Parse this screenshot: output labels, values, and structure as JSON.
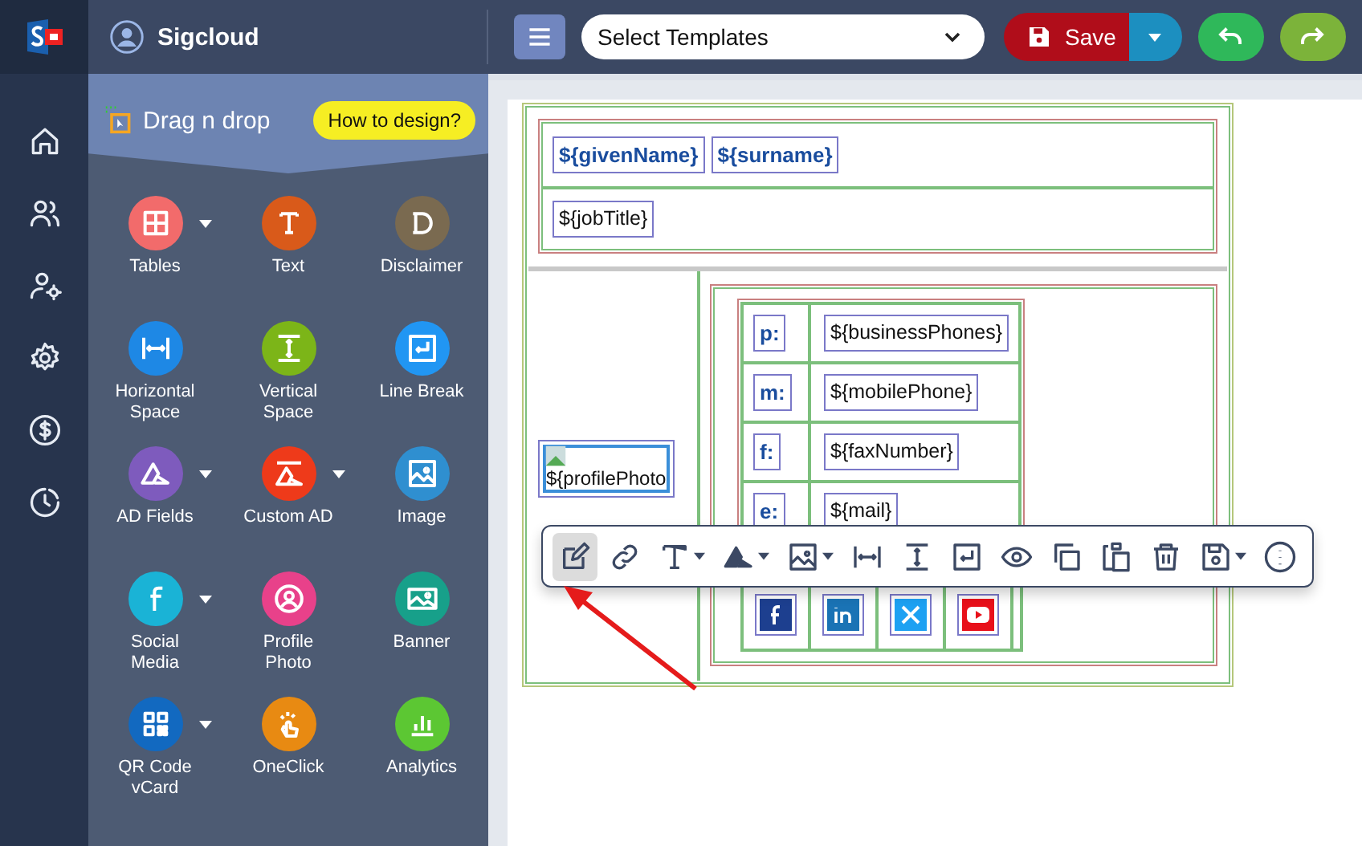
{
  "header": {
    "brand": "Sigcloud",
    "template_select": {
      "placeholder": "Select Templates"
    },
    "save_label": "Save"
  },
  "rail": [
    {
      "kind": "home"
    },
    {
      "kind": "users"
    },
    {
      "kind": "user-settings"
    },
    {
      "kind": "settings"
    },
    {
      "kind": "dollar"
    },
    {
      "kind": "clock"
    }
  ],
  "panel": {
    "title": "Drag n drop",
    "help_button": "How to design?",
    "items": [
      {
        "label": "Tables",
        "kind": "tables",
        "color": "#f26b6b",
        "dropdown": true
      },
      {
        "label": "Text",
        "kind": "text",
        "color": "#d95a1a",
        "dropdown": false
      },
      {
        "label": "Disclaimer",
        "kind": "disclaimer",
        "color": "#7a6a50",
        "dropdown": false
      },
      {
        "label": "Horizontal Space",
        "kind": "hspace",
        "color": "#1e88e5",
        "dropdown": false
      },
      {
        "label": "Vertical Space",
        "kind": "vspace",
        "color": "#7cb518",
        "dropdown": false
      },
      {
        "label": "Line Break",
        "kind": "linebreak",
        "color": "#2196f3",
        "dropdown": false
      },
      {
        "label": "AD Fields",
        "kind": "ad",
        "color": "#7e5bbd",
        "dropdown": true
      },
      {
        "label": "Custom AD",
        "kind": "customad",
        "color": "#ee3a1a",
        "dropdown": true
      },
      {
        "label": "Image",
        "kind": "image",
        "color": "#2f8fd0",
        "dropdown": false
      },
      {
        "label": "Social Media",
        "kind": "social",
        "color": "#1ab3d6",
        "dropdown": true
      },
      {
        "label": "Profile Photo",
        "kind": "profile",
        "color": "#e8418a",
        "dropdown": false
      },
      {
        "label": "Banner",
        "kind": "banner",
        "color": "#17a08a",
        "dropdown": false
      },
      {
        "label": "QR Code vCard",
        "kind": "qr",
        "color": "#1269c0",
        "dropdown": true
      },
      {
        "label": "OneClick",
        "kind": "oneclick",
        "color": "#e88a12",
        "dropdown": false
      },
      {
        "label": "Analytics",
        "kind": "analytics",
        "color": "#5cc733",
        "dropdown": false
      }
    ]
  },
  "signature": {
    "name_fields": [
      "${givenName}",
      "${surname}"
    ],
    "job_title": "${jobTitle}",
    "profile_photo": "${profilePhoto",
    "contacts": [
      {
        "label": "p:",
        "value": "${businessPhones}"
      },
      {
        "label": "m:",
        "value": "${mobilePhone}"
      },
      {
        "label": "f:",
        "value": "${faxNumber}"
      },
      {
        "label": "e:",
        "value": "${mail}"
      }
    ],
    "socials": [
      {
        "kind": "facebook",
        "color": "#1d3f8f"
      },
      {
        "kind": "linkedin",
        "color": "#1a73b5"
      },
      {
        "kind": "x",
        "color": "#1da1f2"
      },
      {
        "kind": "youtube",
        "color": "#e8101a"
      }
    ]
  },
  "toolbar": [
    {
      "kind": "edit",
      "dropdown": false,
      "selected": true
    },
    {
      "kind": "link",
      "dropdown": false,
      "selected": false
    },
    {
      "kind": "font",
      "dropdown": true,
      "selected": false
    },
    {
      "kind": "ad",
      "dropdown": true,
      "selected": false
    },
    {
      "kind": "image",
      "dropdown": true,
      "selected": false
    },
    {
      "kind": "hspace",
      "dropdown": false,
      "selected": false
    },
    {
      "kind": "vspace",
      "dropdown": false,
      "selected": false
    },
    {
      "kind": "linebreak",
      "dropdown": false,
      "selected": false
    },
    {
      "kind": "preview",
      "dropdown": false,
      "selected": false
    },
    {
      "kind": "copy",
      "dropdown": false,
      "selected": false
    },
    {
      "kind": "paste",
      "dropdown": false,
      "selected": false
    },
    {
      "kind": "delete",
      "dropdown": false,
      "selected": false
    },
    {
      "kind": "save",
      "dropdown": true,
      "selected": false
    },
    {
      "kind": "more",
      "dropdown": false,
      "selected": false
    }
  ]
}
